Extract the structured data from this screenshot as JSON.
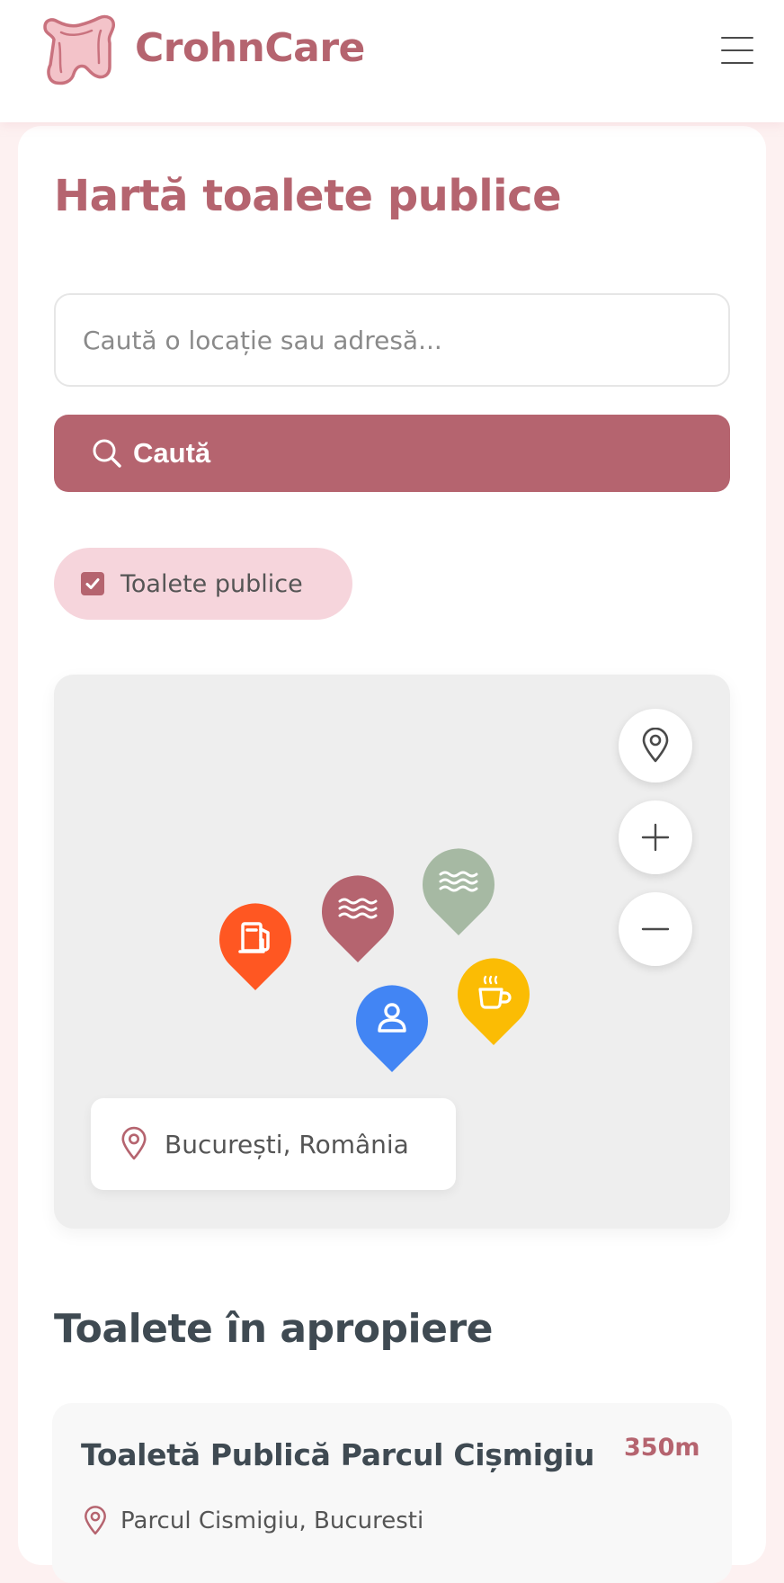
{
  "header": {
    "brand": "CrohnCare",
    "logo_icon": "intestine-icon",
    "menu_icon": "hamburger-menu-icon"
  },
  "page": {
    "title": "Hartă toalete publice"
  },
  "search": {
    "placeholder": "Caută o locație sau adresă...",
    "button_label": "Caută",
    "button_icon": "search-icon"
  },
  "filters": {
    "public_toilets": {
      "label": "Toalete publice",
      "checked": true
    }
  },
  "map": {
    "controls": [
      "locate-icon",
      "zoom-in-icon",
      "zoom-out-icon"
    ],
    "markers": [
      {
        "icon": "gas-station-icon",
        "color": "#ff5722"
      },
      {
        "icon": "waves-icon",
        "color": "#b5646f"
      },
      {
        "icon": "waves-icon",
        "color": "#a6b9a3"
      },
      {
        "icon": "person-icon",
        "color": "#4285f4"
      },
      {
        "icon": "coffee-icon",
        "color": "#fbbc04"
      }
    ],
    "current_location": "București, România"
  },
  "nearby": {
    "title": "Toalete în apropiere",
    "items": [
      {
        "name": "Toaletă Publică Parcul Cișmigiu",
        "distance": "350m",
        "address": "Parcul Cismigiu, Bucuresti"
      }
    ]
  },
  "colors": {
    "brand": "#b5646f",
    "chip_bg": "#f6d5dc",
    "page_bg": "#fdf1f1",
    "heading_dark": "#3f4a52"
  }
}
